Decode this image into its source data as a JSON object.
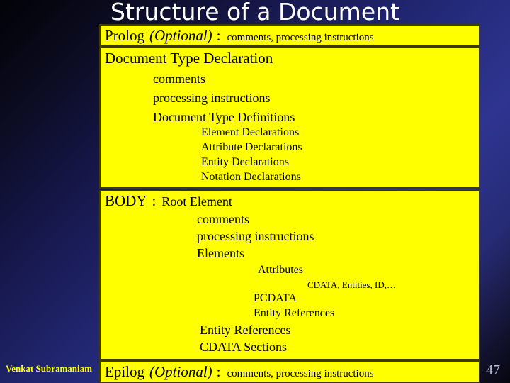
{
  "slide": {
    "title": "Structure of a Document",
    "page_number": "47",
    "footer_author": "Venkat Subramaniam",
    "colors": {
      "box_fill": "#ffff00",
      "box_border": "#403a06",
      "title_text": "#ffffff",
      "body_text": "#000000",
      "footer_text": "#ffff00",
      "page_number_text": "#b9bcd8",
      "background_dark": "#020207",
      "background_blue": "#2e3590"
    }
  },
  "prolog": {
    "label": "Prolog",
    "optional": "(Optional)",
    "colon": ":",
    "detail": "comments, processing instructions"
  },
  "dtd": {
    "heading": "Document Type Declaration",
    "level1": [
      "comments",
      "processing instructions",
      "Document Type Definitions"
    ],
    "level2": [
      "Element Declarations",
      "Attribute Declarations",
      "Entity Declarations",
      "Notation Declarations"
    ]
  },
  "body": {
    "label": "BODY",
    "colon": ":",
    "root": "Root Element",
    "level1": [
      "comments",
      "processing instructions",
      "Elements"
    ],
    "attributes": "Attributes",
    "attribute_types": "CDATA, Entities, ID,…",
    "element_children": [
      "PCDATA",
      "Entity References"
    ],
    "level1_tail": [
      "Entity References",
      "CDATA Sections"
    ]
  },
  "epilog": {
    "label": "Epilog",
    "optional": "(Optional)",
    "colon": ":",
    "detail": "comments, processing instructions"
  }
}
